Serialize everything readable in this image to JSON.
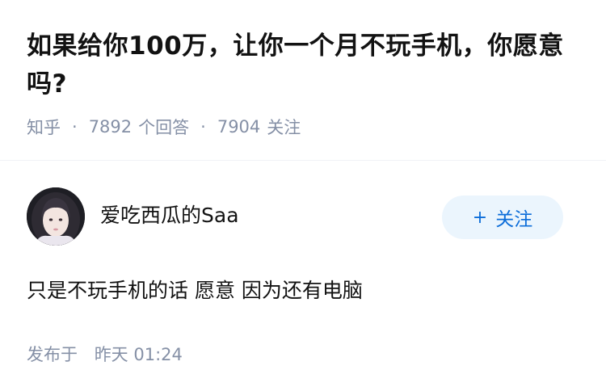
{
  "question": {
    "title": "如果给你100万，让你一个月不玩手机，你愿意吗?",
    "source": "知乎",
    "answer_count": "7892",
    "answer_label": "个回答",
    "follow_count": "7904",
    "follow_label": "关注"
  },
  "answer": {
    "author_name": "爱吃西瓜的Saa",
    "follow_button": {
      "icon": "+",
      "label": "关注"
    },
    "content": "只是不玩手机的话 愿意 因为还有电脑",
    "published_label": "发布于",
    "published_time": "昨天 01:24"
  },
  "colors": {
    "meta_gray": "#8590a6",
    "follow_blue": "#0c6dd9",
    "follow_bg": "#ebf5fd"
  }
}
